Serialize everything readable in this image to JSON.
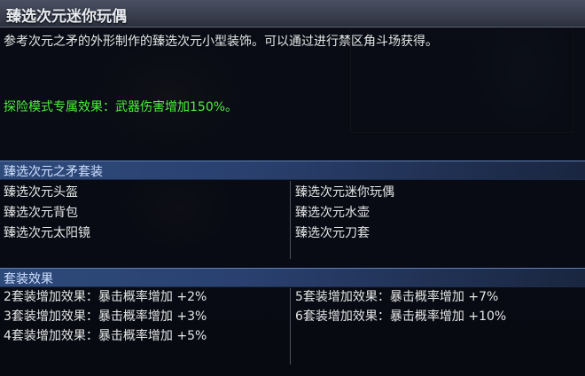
{
  "tooltip": {
    "title": "臻选次元迷你玩偶",
    "description": "参考次元之矛的外形制作的臻选次元小型装饰。可以通过进行禁区角斗场获得。",
    "exclusive_effect": "探险模式专属效果：武器伤害增加150%。"
  },
  "set": {
    "header": "臻选次元之矛套装",
    "items_left": [
      "臻选次元头盔",
      "臻选次元背包",
      "臻选次元太阳镜"
    ],
    "items_right": [
      "臻选次元迷你玩偶",
      "臻选次元水壶",
      "臻选次元刀套"
    ]
  },
  "set_effects": {
    "header": "套装效果",
    "left": [
      "2套装增加效果：暴击概率增加 +2%",
      "3套装增加效果：暴击概率增加 +3%",
      "4套装增加效果：暴击概率增加 +5%"
    ],
    "right": [
      "5套装增加效果：暴击概率增加 +7%",
      "6套装增加效果：暴击概率增加 +10%"
    ]
  },
  "colors": {
    "effect_green": "#4cf03c",
    "section_blue": "#2e4a7a",
    "text": "#e6e6e6"
  }
}
